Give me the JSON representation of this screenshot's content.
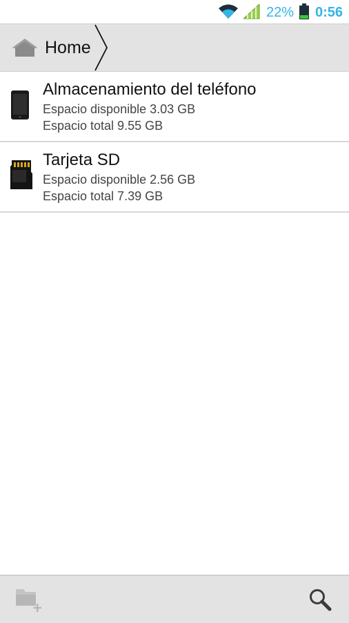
{
  "status_bar": {
    "battery_percent": "22%",
    "time": "0:56",
    "accent_color": "#33b5e5",
    "icons": [
      "wifi-icon",
      "signal-icon",
      "battery-icon"
    ]
  },
  "breadcrumb": {
    "items": [
      {
        "label": "Home",
        "icon": "home-icon"
      }
    ]
  },
  "storage": {
    "items": [
      {
        "title": "Almacenamiento del teléfono",
        "free": "Espacio disponible 3.03 GB",
        "total": "Espacio total 9.55 GB",
        "icon": "phone-icon"
      },
      {
        "title": "Tarjeta SD",
        "free": "Espacio disponible 2.56 GB",
        "total": "Espacio total 7.39 GB",
        "icon": "sd-card-icon"
      }
    ]
  },
  "bottom_bar": {
    "icons": [
      "new-folder-icon",
      "search-icon"
    ]
  }
}
